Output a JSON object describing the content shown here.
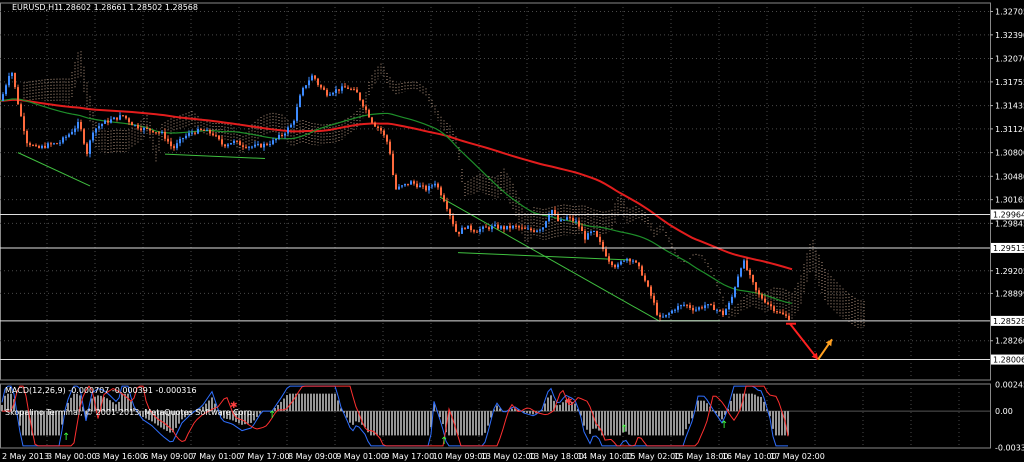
{
  "header": {
    "symbol": "EURUSD,H1",
    "ohlc": "1.28602 1.28661 1.28502 1.28568"
  },
  "macd_label": "MACD(12,26,9) -0.000707 -0.000391 -0.000316",
  "copyright": "Skopalino Terminal, © 2001-2013, MetaQuotes Software Corp.",
  "colors": {
    "background": "#000000",
    "bull": "#3d8bff",
    "bear": "#ff6a3d",
    "ma_red": "#e31d1d",
    "ma_green": "#1e8f2a",
    "cloud": "#d8b49a",
    "hline": "#e0e0e0",
    "arrow_red": "#ff2020",
    "arrow_orange": "#ffa020",
    "macd_hist": "#c8c8c8",
    "macd_blue": "#2f6fff",
    "macd_red": "#ff3030",
    "grid": "#4a4a4a"
  },
  "chart_data": [
    {
      "type": "candlestick",
      "title": "EURUSD,H1",
      "ylim": [
        1.2773,
        1.3282
      ],
      "price_ticks": [
        "1.32705",
        "1.32390",
        "1.32070",
        "1.31755",
        "1.31435",
        "1.31120",
        "1.30800",
        "1.30480",
        "1.30165",
        "1.29845",
        "1.29205",
        "1.28899",
        "1.28260"
      ],
      "price_levels": [
        {
          "label": "1.29964",
          "value": 1.29964
        },
        {
          "label": "1.29513",
          "value": 1.29513
        },
        {
          "label": "1.28528",
          "value": 1.28528
        },
        {
          "label": "1.28006",
          "value": 1.28006
        }
      ],
      "time_labels": [
        "2 May 2013",
        "3 May 00:00",
        "3 May 16:00",
        "6 May 09:00",
        "7 May 01:00",
        "7 May 17:00",
        "8 May 09:00",
        "9 May 01:00",
        "9 May 17:00",
        "10 May 09:00",
        "13 May 02:00",
        "13 May 18:00",
        "14 May 10:00",
        "15 May 02:00",
        "15 May 18:00",
        "16 May 10:00",
        "17 May 02:00"
      ],
      "price_path": [
        [
          0,
          1.315
        ],
        [
          10,
          1.3195
        ],
        [
          18,
          1.314
        ],
        [
          26,
          1.3095
        ],
        [
          36,
          1.3085
        ],
        [
          46,
          1.309
        ],
        [
          58,
          1.3093
        ],
        [
          68,
          1.3105
        ],
        [
          78,
          1.312
        ],
        [
          86,
          1.308
        ],
        [
          92,
          1.311
        ],
        [
          102,
          1.312
        ],
        [
          112,
          1.3125
        ],
        [
          122,
          1.313
        ],
        [
          132,
          1.3118
        ],
        [
          142,
          1.3112
        ],
        [
          152,
          1.311
        ],
        [
          162,
          1.3105
        ],
        [
          172,
          1.3085
        ],
        [
          182,
          1.31
        ],
        [
          192,
          1.3108
        ],
        [
          202,
          1.311
        ],
        [
          212,
          1.3105
        ],
        [
          222,
          1.309
        ],
        [
          232,
          1.3095
        ],
        [
          242,
          1.309
        ],
        [
          252,
          1.3088
        ],
        [
          262,
          1.309
        ],
        [
          272,
          1.3095
        ],
        [
          282,
          1.3105
        ],
        [
          292,
          1.312
        ],
        [
          300,
          1.316
        ],
        [
          306,
          1.3175
        ],
        [
          312,
          1.3185
        ],
        [
          318,
          1.317
        ],
        [
          326,
          1.316
        ],
        [
          336,
          1.3165
        ],
        [
          346,
          1.3168
        ],
        [
          356,
          1.316
        ],
        [
          364,
          1.314
        ],
        [
          372,
          1.312
        ],
        [
          380,
          1.311
        ],
        [
          388,
          1.309
        ],
        [
          394,
          1.303
        ],
        [
          402,
          1.3035
        ],
        [
          410,
          1.304
        ],
        [
          418,
          1.3035
        ],
        [
          426,
          1.303
        ],
        [
          434,
          1.304
        ],
        [
          442,
          1.302
        ],
        [
          448,
          1.3
        ],
        [
          456,
          1.297
        ],
        [
          464,
          1.298
        ],
        [
          474,
          1.2975
        ],
        [
          484,
          1.2978
        ],
        [
          494,
          1.298
        ],
        [
          504,
          1.2978
        ],
        [
          514,
          1.298
        ],
        [
          524,
          1.2976
        ],
        [
          534,
          1.2975
        ],
        [
          542,
          1.298
        ],
        [
          550,
          1.3005
        ],
        [
          558,
          1.2985
        ],
        [
          566,
          1.2992
        ],
        [
          576,
          1.2986
        ],
        [
          584,
          1.2965
        ],
        [
          592,
          1.2974
        ],
        [
          600,
          1.2955
        ],
        [
          608,
          1.2935
        ],
        [
          616,
          1.2925
        ],
        [
          624,
          1.2938
        ],
        [
          632,
          1.2935
        ],
        [
          640,
          1.292
        ],
        [
          646,
          1.29
        ],
        [
          652,
          1.288
        ],
        [
          658,
          1.2855
        ],
        [
          666,
          1.286
        ],
        [
          674,
          1.287
        ],
        [
          684,
          1.2875
        ],
        [
          694,
          1.2868
        ],
        [
          704,
          1.2874
        ],
        [
          714,
          1.287
        ],
        [
          722,
          1.2862
        ],
        [
          730,
          1.288
        ],
        [
          736,
          1.291
        ],
        [
          742,
          1.2935
        ],
        [
          748,
          1.2915
        ],
        [
          756,
          1.289
        ],
        [
          764,
          1.288
        ],
        [
          772,
          1.287
        ],
        [
          780,
          1.2862
        ],
        [
          788,
          1.2857
        ]
      ],
      "annotations": [
        {
          "type": "arrow",
          "points": [
            [
              790,
              1.2849
            ],
            [
              818,
              1.28006
            ]
          ],
          "color": "#ff2020"
        },
        {
          "type": "arrow",
          "points": [
            [
              818,
              1.28006
            ],
            [
              832,
              1.2828
            ]
          ],
          "color": "#ffa020"
        }
      ]
    },
    {
      "type": "macd",
      "label": "MACD(12,26,9)",
      "values": {
        "main": -0.000707,
        "signal": -0.000391,
        "histogram": -0.000316
      },
      "ylim": [
        -0.0034,
        0.0025
      ],
      "ticks": [
        "0.002459",
        "0.00",
        "-0.003345"
      ]
    }
  ]
}
